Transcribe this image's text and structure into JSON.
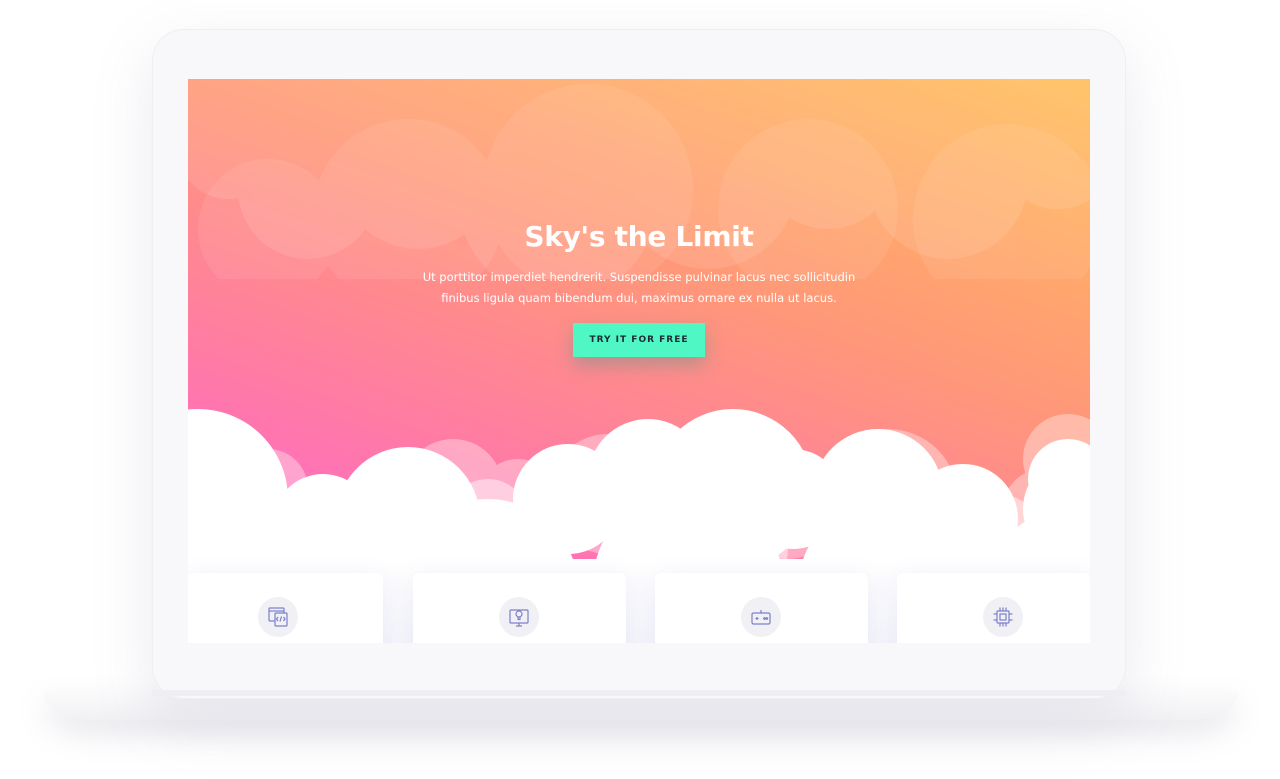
{
  "hero": {
    "title": "Sky's the Limit",
    "text": "Ut porttitor imperdiet hendrerit. Suspendisse pulvinar lacus nec sollicitudin finibus ligula quam bibendum dui, maximus ornare ex nulla ut lacus.",
    "cta_label": "TRY IT FOR FREE"
  },
  "colors": {
    "gradient_top_right": "#ffbe5a",
    "gradient_bottom_left": "#ff5de0",
    "cta_background": "#4ff7c4",
    "icon_stroke": "#7b7fc9"
  },
  "features": [
    {
      "icon": "code-window-icon"
    },
    {
      "icon": "lightbulb-monitor-icon"
    },
    {
      "icon": "gamepad-icon"
    },
    {
      "icon": "cpu-chip-icon"
    }
  ]
}
